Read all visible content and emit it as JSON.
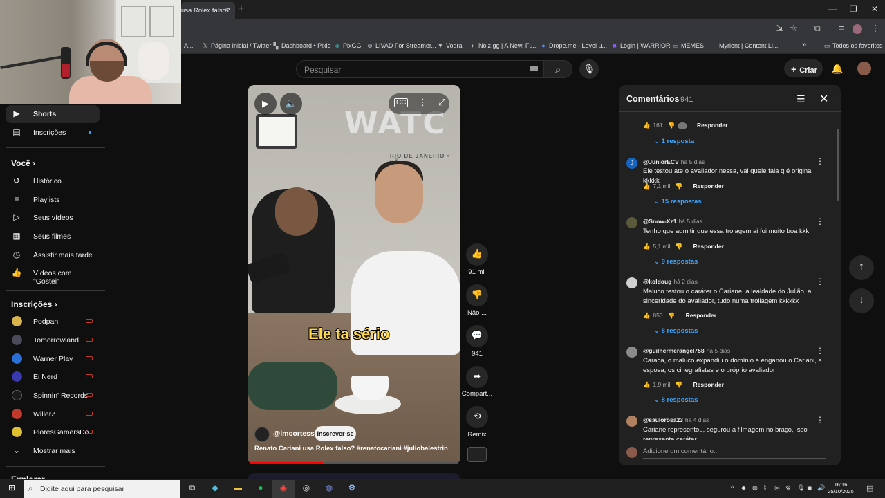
{
  "browser": {
    "tab_title": "usa Rolex falso?",
    "new_tab": "+",
    "window": {
      "minimize": "—",
      "restore": "❐",
      "close": "✕"
    },
    "bookmarks": [
      {
        "icon": "x-icon",
        "label": "Página Inicial / Twitter"
      },
      {
        "icon": "pixie-icon",
        "label": "Dashboard • Pixie"
      },
      {
        "icon": "pixgg-icon",
        "label": "PixGG"
      },
      {
        "icon": "livad-icon",
        "label": "LIVAD For Streamer..."
      },
      {
        "icon": "vodra-icon",
        "label": "Vodra"
      },
      {
        "icon": "noiz-icon",
        "label": "Noiz.gg | A New, Fu..."
      },
      {
        "icon": "drope-icon",
        "label": "Drope.me - Level u..."
      },
      {
        "icon": "warrior-icon",
        "label": "Login | WARRIOR"
      },
      {
        "icon": "folder-icon",
        "label": "MEMES"
      },
      {
        "icon": "myrient-icon",
        "label": "Myrient | Content Li..."
      }
    ],
    "bookmarks_prefix": "A...",
    "bookmarks_more": "»",
    "all_bookmarks": "Todos os favoritos"
  },
  "youtube": {
    "search_placeholder": "Pesquisar",
    "create_label": "Criar",
    "sidebar": {
      "top_items": [
        {
          "icon": "shorts-icon",
          "label": "Shorts",
          "active": true
        },
        {
          "icon": "subscriptions-icon",
          "label": "Inscrições"
        }
      ],
      "you_header": "Você",
      "you_items": [
        {
          "icon": "history-icon",
          "label": "Histórico"
        },
        {
          "icon": "playlists-icon",
          "label": "Playlists"
        },
        {
          "icon": "your-videos-icon",
          "label": "Seus vídeos"
        },
        {
          "icon": "movies-icon",
          "label": "Seus filmes"
        },
        {
          "icon": "watch-later-icon",
          "label": "Assistir mais tarde"
        },
        {
          "icon": "liked-icon",
          "label": "Vídeos com \"Gostei\""
        }
      ],
      "subs_header": "Inscrições",
      "subscriptions": [
        {
          "label": "Podpah",
          "color": "#d8b24a"
        },
        {
          "label": "Tomorrowland",
          "color": "#4a4a5a"
        },
        {
          "label": "Warner Play",
          "color": "#2a6fd6"
        },
        {
          "label": "Ei Nerd",
          "color": "#3a3ab0"
        },
        {
          "label": "Spinnin' Records",
          "color": "#1a1a1a"
        },
        {
          "label": "WillerZ",
          "color": "#c0392b"
        },
        {
          "label": "PioresGamersDo...",
          "color": "#e0c030"
        }
      ],
      "show_more": "Mostrar mais",
      "explore_header": "Explorar"
    },
    "short": {
      "caption": "Ele ta sério",
      "sign_text": "WATC",
      "sign_sub": "RIO DE JANEIRO • SÃ",
      "channel": "@lmcortesss",
      "subscribe": "Inscrever-se",
      "title_plain": "Renato Cariani usa Rolex falso? ",
      "title_tags": "#renatocariani #juliobalestrin",
      "progress": 0.35,
      "actions": {
        "likes": "91 mil",
        "dislike": "Não ...",
        "comments": "941",
        "share": "Compart...",
        "remix": "Remix"
      }
    },
    "comments_panel": {
      "title": "Comentários",
      "count": "941",
      "first_partial": {
        "likes": "161",
        "reply": "Responder",
        "replies": "1 resposta"
      },
      "items": [
        {
          "user": "@JuniorECV",
          "time": "há 5 dias",
          "text": "Ele testou ate o avaliador nessa, vai quele fala q é original kkkkk",
          "likes": "7,1 mil",
          "reply": "Responder",
          "replies": "15 respostas",
          "avatar_color": "#1565c0",
          "avatar_letter": "J"
        },
        {
          "user": "@Snow-Xz1",
          "time": "há 5 dias",
          "text": "Tenho que admitir que essa trolagem ai foi muito boa kkk",
          "likes": "5,1 mil",
          "reply": "Responder",
          "replies": "9 respostas",
          "avatar_color": "#5a5a3a",
          "avatar_letter": ""
        },
        {
          "user": "@koldoug",
          "time": "há 2 dias",
          "text": "Maluco testou o caráter o Cariane, a lealdade do Julião, a sinceridade do avaliador, tudo numa trollagem kkkkkk",
          "likes": "850",
          "reply": "Responder",
          "replies": "8 respostas",
          "avatar_color": "#d0d0d0",
          "avatar_letter": ""
        },
        {
          "user": "@guilhermerangel758",
          "time": "há 5 dias",
          "text": "Caraca, o maluco expandiu o domínio e enganou o Cariani, a esposa, os cinegrafistas e o próprio avaliador",
          "likes": "1,9 mil",
          "reply": "Responder",
          "replies": "8 respostas",
          "avatar_color": "#8a8a8a",
          "avatar_letter": ""
        },
        {
          "user": "@saulorosa23",
          "time": "há 4 dias",
          "text": "Cariane representou, segurou a filmagem no braço, Isso representa caráter",
          "likes": "",
          "reply": "",
          "replies": "",
          "avatar_color": "#b08060",
          "avatar_letter": ""
        }
      ],
      "add_placeholder": "Adicione um comentário..."
    }
  },
  "taskbar": {
    "search_placeholder": "Digite aqui para pesquisar",
    "time": "16:16",
    "date": "25/10/2025"
  }
}
